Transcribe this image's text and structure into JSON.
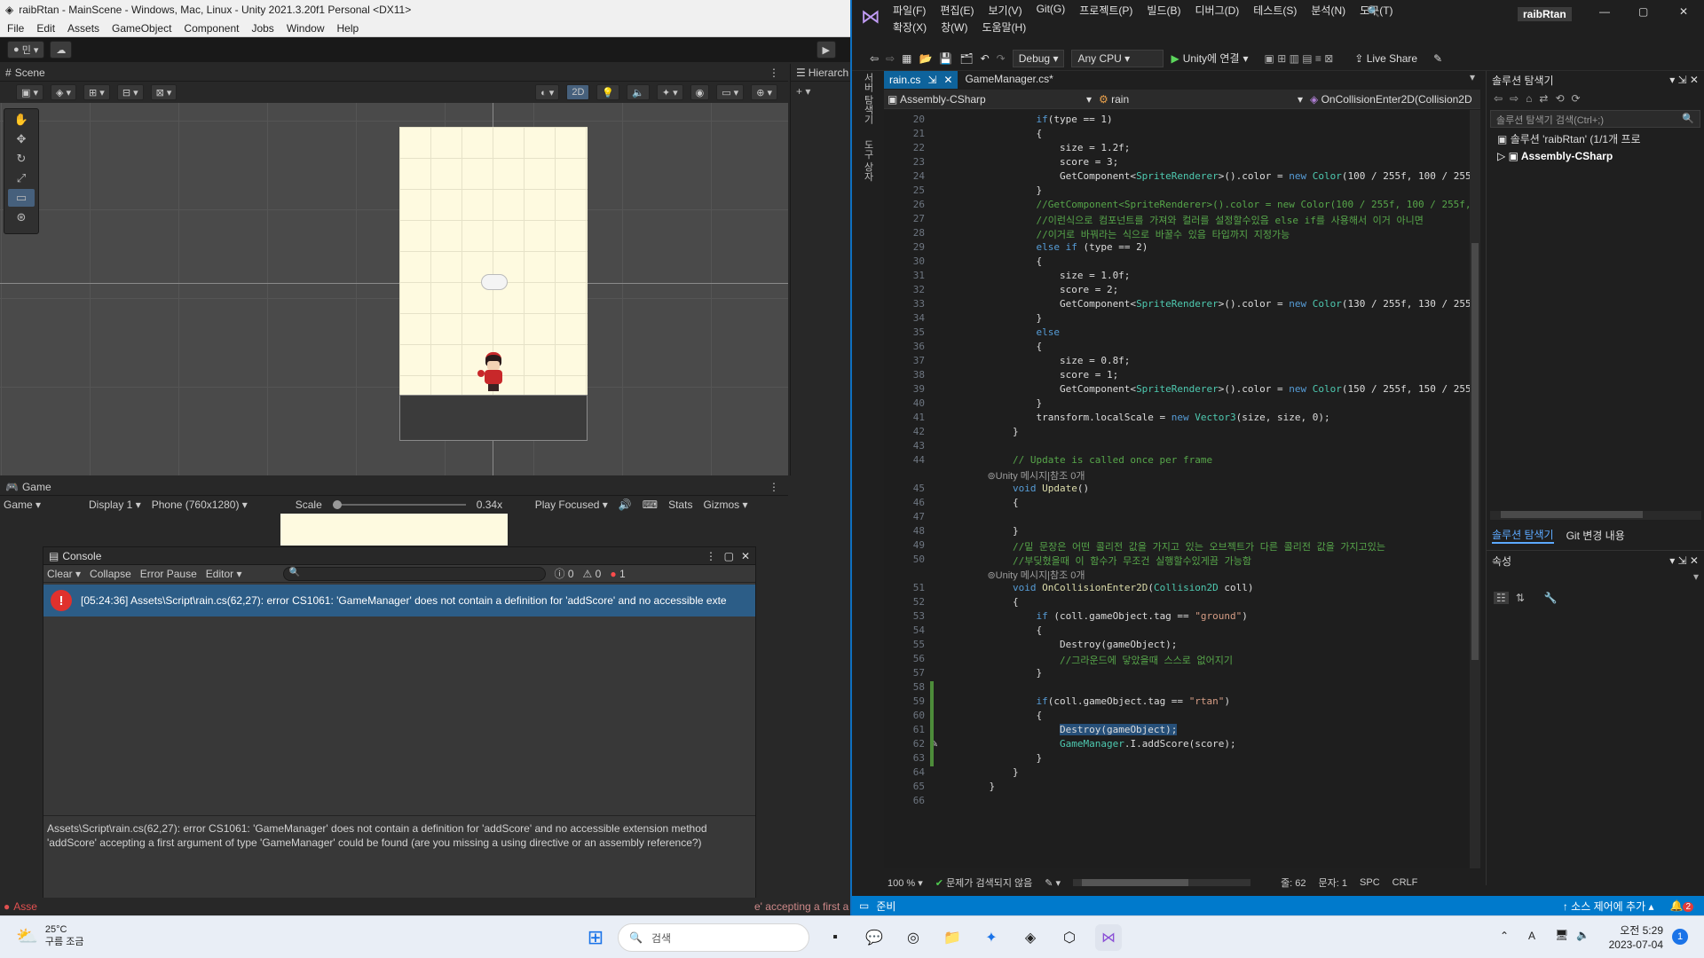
{
  "unity": {
    "title": "raibRtan - MainScene - Windows, Mac, Linux - Unity 2021.3.20f1 Personal <DX11>",
    "menu": [
      "File",
      "Edit",
      "Assets",
      "GameObject",
      "Component",
      "Jobs",
      "Window",
      "Help"
    ],
    "account": "민",
    "scene_tab": "Scene",
    "hierarchy_tab": "Hierarch",
    "btn_2d": "2D",
    "game_tab": "Game",
    "game_bar": {
      "mode": "Game",
      "display": "Display 1",
      "resolution": "Phone (760x1280)",
      "scale_label": "Scale",
      "scale_value": "0.34x",
      "play_focused": "Play Focused",
      "stats": "Stats",
      "gizmos": "Gizmos"
    },
    "console": {
      "tab": "Console",
      "clear": "Clear",
      "collapse": "Collapse",
      "error_pause": "Error Pause",
      "editor": "Editor",
      "count_info": "0",
      "count_warn": "0",
      "count_error": "1",
      "error_line": "[05:24:36] Assets\\Script\\rain.cs(62,27): error CS1061: 'GameManager' does not contain a definition for 'addScore' and no accessible exte",
      "detail_1": "Assets\\Script\\rain.cs(62,27): error CS1061: 'GameManager' does not contain a definition for 'addScore' and no accessible extension method",
      "detail_2": "'addScore' accepting a first argument of type 'GameManager' could be found (are you missing a using directive or an assembly reference?)"
    },
    "status_left": "Asse",
    "status_right": "e' accepting a first a"
  },
  "vs": {
    "menu_row1": [
      "파일(F)",
      "편집(E)",
      "보기(V)",
      "Git(G)",
      "프로젝트(P)",
      "빌드(B)",
      "디버그(D)",
      "테스트(S)",
      "분석(N)",
      "도구(T)"
    ],
    "menu_row2": [
      "확장(X)",
      "창(W)",
      "도움말(H)"
    ],
    "solution_name": "raibRtan",
    "config": "Debug",
    "platform": "Any CPU",
    "run": "Unity에 연결",
    "live_share": "Live Share",
    "tab_active": "rain.cs",
    "tab_other": "GameManager.cs*",
    "nav_project": "Assembly-CSharp",
    "nav_class": "rain",
    "nav_member": "OnCollisionEnter2D(Collision2D coll)",
    "side_tabs": [
      "서버 탐색기",
      "도구 상자"
    ],
    "zoom": "100 %",
    "issues": "문제가 검색되지 않음",
    "line_pos": "줄: 62",
    "col_pos": "문자: 1",
    "spc": "SPC",
    "crlf": "CRLF",
    "ready": "준비",
    "source_control": "소스 제어에 추가",
    "notif_count": "2",
    "solution_explorer": {
      "title": "솔루션 탐색기",
      "search": "솔루션 탐색기 검색(Ctrl+;)",
      "root": "솔루션 'raibRtan' (1/1개 프로",
      "project": "Assembly-CSharp",
      "tabs": [
        "솔루션 탐색기",
        "Git 변경 내용"
      ]
    },
    "properties": {
      "title": "속성"
    }
  },
  "code_lines": [
    {
      "n": "20",
      "html": "            <span class='kw'>if</span>(type == 1)"
    },
    {
      "n": "21",
      "html": "            {"
    },
    {
      "n": "22",
      "html": "                size = 1.2f;"
    },
    {
      "n": "23",
      "html": "                score = 3;"
    },
    {
      "n": "24",
      "html": "                GetComponent&lt;<span class='ty'>SpriteRenderer</span>&gt;().color = <span class='kw'>new</span> <span class='ty'>Color</span>(100 / 255f, 100 / 255f, 255"
    },
    {
      "n": "25",
      "html": "            }"
    },
    {
      "n": "26",
      "html": "            <span class='cm'>//GetComponent&lt;SpriteRenderer&gt;().color = new Color(100 / 255f, 100 / 255f,</span>"
    },
    {
      "n": "27",
      "html": "            <span class='cm'>//이런식으로 컴포넌트를 가져와 컬러를 설정할수있음 else if를 사용해서 이거 아니면</span>"
    },
    {
      "n": "28",
      "html": "            <span class='cm'>//이거로 바꿔라는 식으로 바꿀수 있음 타입까지 지정가능</span>"
    },
    {
      "n": "29",
      "html": "            <span class='kw'>else if</span> (type == 2)"
    },
    {
      "n": "30",
      "html": "            {"
    },
    {
      "n": "31",
      "html": "                size = 1.0f;"
    },
    {
      "n": "32",
      "html": "                score = 2;"
    },
    {
      "n": "33",
      "html": "                GetComponent&lt;<span class='ty'>SpriteRenderer</span>&gt;().color = <span class='kw'>new</span> <span class='ty'>Color</span>(130 / 255f, 130 / 255f, 255"
    },
    {
      "n": "34",
      "html": "            }"
    },
    {
      "n": "35",
      "html": "            <span class='kw'>else</span>"
    },
    {
      "n": "36",
      "html": "            {"
    },
    {
      "n": "37",
      "html": "                size = 0.8f;"
    },
    {
      "n": "38",
      "html": "                score = 1;"
    },
    {
      "n": "39",
      "html": "                GetComponent&lt;<span class='ty'>SpriteRenderer</span>&gt;().color = <span class='kw'>new</span> <span class='ty'>Color</span>(150 / 255f, 150 / 255f, 255"
    },
    {
      "n": "40",
      "html": "            }"
    },
    {
      "n": "41",
      "html": "            transform.localScale = <span class='kw'>new</span> <span class='ty'>Vector3</span>(size, size, 0);"
    },
    {
      "n": "42",
      "html": "        }"
    },
    {
      "n": "43",
      "html": ""
    },
    {
      "n": "44",
      "html": "        <span class='cm'>// Update is called once per frame</span>"
    },
    {
      "n": "",
      "meta": "⊚Unity 메시지|참조 0개"
    },
    {
      "n": "45",
      "html": "        <span class='kw'>void</span> <span class='fn'>Update</span>()"
    },
    {
      "n": "46",
      "html": "        {"
    },
    {
      "n": "47",
      "html": ""
    },
    {
      "n": "48",
      "html": "        }"
    },
    {
      "n": "49",
      "html": "        <span class='cm'>//밑 문장은 어떤 콜리전 값을 가지고 있는 오브젝트가 다른 콜리전 값을 가지고있는</span>"
    },
    {
      "n": "50",
      "html": "        <span class='cm'>//부딪혔을때 이 함수가 무조건 실행할수있게끔 가능함</span>"
    },
    {
      "n": "",
      "meta": "⊚Unity 메시지|참조 0개"
    },
    {
      "n": "51",
      "html": "        <span class='kw'>void</span> <span class='fn'>OnCollisionEnter2D</span>(<span class='ty'>Collision2D</span> coll)"
    },
    {
      "n": "52",
      "html": "        {"
    },
    {
      "n": "53",
      "html": "            <span class='kw'>if</span> (coll.gameObject.tag == <span class='st'>\"ground\"</span>)"
    },
    {
      "n": "54",
      "html": "            {"
    },
    {
      "n": "55",
      "html": "                Destroy(gameObject);"
    },
    {
      "n": "56",
      "html": "                <span class='cm'>//그라운드에 닿았을때 스스로 없어지기</span>"
    },
    {
      "n": "57",
      "html": "            }"
    },
    {
      "n": "58",
      "html": ""
    },
    {
      "n": "59",
      "html": "            <span class='kw'>if</span>(coll.gameObject.tag == <span class='st'>\"rtan\"</span>)"
    },
    {
      "n": "60",
      "html": "            {"
    },
    {
      "n": "61",
      "html": "                <span style='background:#264f78'>Destroy(gameObject);</span>"
    },
    {
      "n": "62",
      "html": "                <span class='ty'>GameManager</span>.I.addScore(score);"
    },
    {
      "n": "63",
      "html": "            }"
    },
    {
      "n": "64",
      "html": "        }"
    },
    {
      "n": "65",
      "html": "    }"
    },
    {
      "n": "66",
      "html": ""
    }
  ],
  "taskbar": {
    "temp": "25°C",
    "weather": "구름 조금",
    "search": "검색",
    "time": "오전 5:29",
    "date": "2023-07-04",
    "ime": "A",
    "notif": "1"
  }
}
